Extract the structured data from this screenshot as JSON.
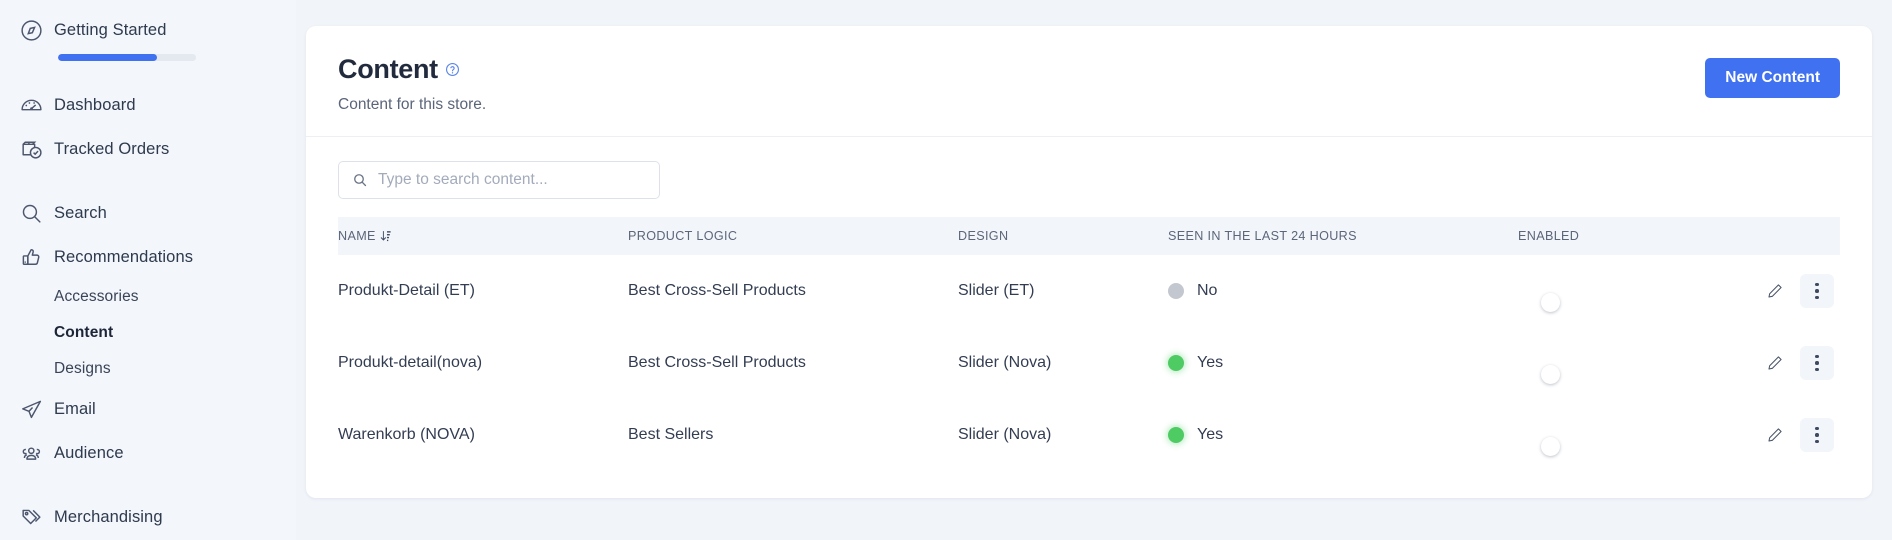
{
  "sidebar": {
    "items": [
      {
        "id": "getting-started",
        "label": "Getting Started",
        "icon": "compass-icon",
        "type": "top",
        "progress": 72
      },
      {
        "id": "dashboard",
        "label": "Dashboard",
        "icon": "gauge-icon",
        "type": "top"
      },
      {
        "id": "tracked-orders",
        "label": "Tracked Orders",
        "icon": "box-check-icon",
        "type": "top"
      },
      {
        "id": "search",
        "label": "Search",
        "icon": "magnifier-icon",
        "type": "top"
      },
      {
        "id": "recommendations",
        "label": "Recommendations",
        "icon": "thumbs-up-icon",
        "type": "top"
      },
      {
        "id": "accessories",
        "label": "Accessories",
        "icon": "",
        "type": "sub"
      },
      {
        "id": "content",
        "label": "Content",
        "icon": "",
        "type": "sub",
        "active": true
      },
      {
        "id": "designs",
        "label": "Designs",
        "icon": "",
        "type": "sub"
      },
      {
        "id": "email",
        "label": "Email",
        "icon": "paper-plane-icon",
        "type": "top"
      },
      {
        "id": "audience",
        "label": "Audience",
        "icon": "people-icon",
        "type": "top"
      },
      {
        "id": "merchandising",
        "label": "Merchandising",
        "icon": "tag-icon",
        "type": "top"
      }
    ]
  },
  "header": {
    "title": "Content",
    "help_icon": "help-circle-icon",
    "subtitle": "Content for this store.",
    "new_button_label": "New Content"
  },
  "search": {
    "placeholder": "Type to search content...",
    "value": "",
    "icon": "search-icon"
  },
  "table": {
    "columns": [
      {
        "key": "name",
        "label": "Name",
        "sortable": true,
        "sort_icon": "sort-icon"
      },
      {
        "key": "product_logic",
        "label": "Product Logic",
        "sortable": false
      },
      {
        "key": "design",
        "label": "Design",
        "sortable": false
      },
      {
        "key": "seen",
        "label": "Seen in the last 24 hours",
        "sortable": false
      },
      {
        "key": "enabled",
        "label": "Enabled",
        "sortable": false
      }
    ],
    "rows": [
      {
        "name": "Produkt-Detail (ET)",
        "product_logic": "Best Cross-Sell Products",
        "design": "Slider (ET)",
        "seen_label": "No",
        "seen_state": "no",
        "enabled": true
      },
      {
        "name": "Produkt-detail(nova)",
        "product_logic": "Best Cross-Sell Products",
        "design": "Slider (Nova)",
        "seen_label": "Yes",
        "seen_state": "yes",
        "enabled": true
      },
      {
        "name": "Warenkorb (NOVA)",
        "product_logic": "Best Sellers",
        "design": "Slider (Nova)",
        "seen_label": "Yes",
        "seen_state": "yes",
        "enabled": true
      }
    ],
    "row_actions": {
      "edit_icon": "pencil-icon",
      "more_icon": "kebab-menu-icon"
    }
  },
  "colors": {
    "accent": "#4071f0",
    "status_yes": "#4ecb63",
    "status_no": "#c3c7cf",
    "page_bg": "#f1f4f9",
    "card_bg": "#ffffff",
    "table_header_bg": "#f2f5fa"
  }
}
